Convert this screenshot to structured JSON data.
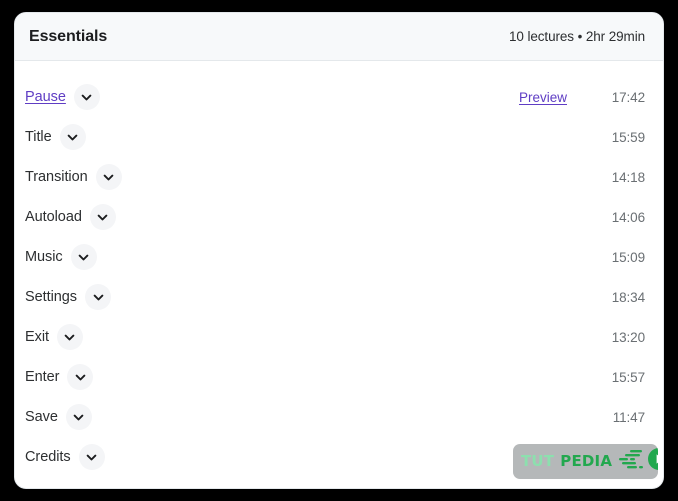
{
  "header": {
    "title": "Essentials",
    "meta": "10 lectures • 2hr 29min"
  },
  "lectures": [
    {
      "title": "Pause",
      "duration": "17:42",
      "is_link": true,
      "preview_label": "Preview",
      "has_preview": true
    },
    {
      "title": "Title",
      "duration": "15:59",
      "is_link": false,
      "has_preview": false
    },
    {
      "title": "Transition",
      "duration": "14:18",
      "is_link": false,
      "has_preview": false
    },
    {
      "title": "Autoload",
      "duration": "14:06",
      "is_link": false,
      "has_preview": false
    },
    {
      "title": "Music",
      "duration": "15:09",
      "is_link": false,
      "has_preview": false
    },
    {
      "title": "Settings",
      "duration": "18:34",
      "is_link": false,
      "has_preview": false
    },
    {
      "title": "Exit",
      "duration": "13:20",
      "is_link": false,
      "has_preview": false
    },
    {
      "title": "Enter",
      "duration": "15:57",
      "is_link": false,
      "has_preview": false
    },
    {
      "title": "Save",
      "duration": "11:47",
      "is_link": false,
      "has_preview": false
    },
    {
      "title": "Credits",
      "duration": "",
      "is_link": false,
      "has_preview": false
    }
  ],
  "watermark": {
    "text_primary": "TUT",
    "text_secondary": "PEDIA",
    "icon": "play-circle-icon"
  },
  "icons": {
    "chevron": "chevron-down-icon"
  },
  "colors": {
    "link_purple": "#5f3dc4",
    "title_dark": "#1c1d1f",
    "duration_gray": "#6a6f73",
    "card_white": "#ffffff",
    "header_gray": "#f7f9fa",
    "page_black": "#000000",
    "watermark_green_light": "#8ce0ae",
    "watermark_green": "#22a84e"
  }
}
